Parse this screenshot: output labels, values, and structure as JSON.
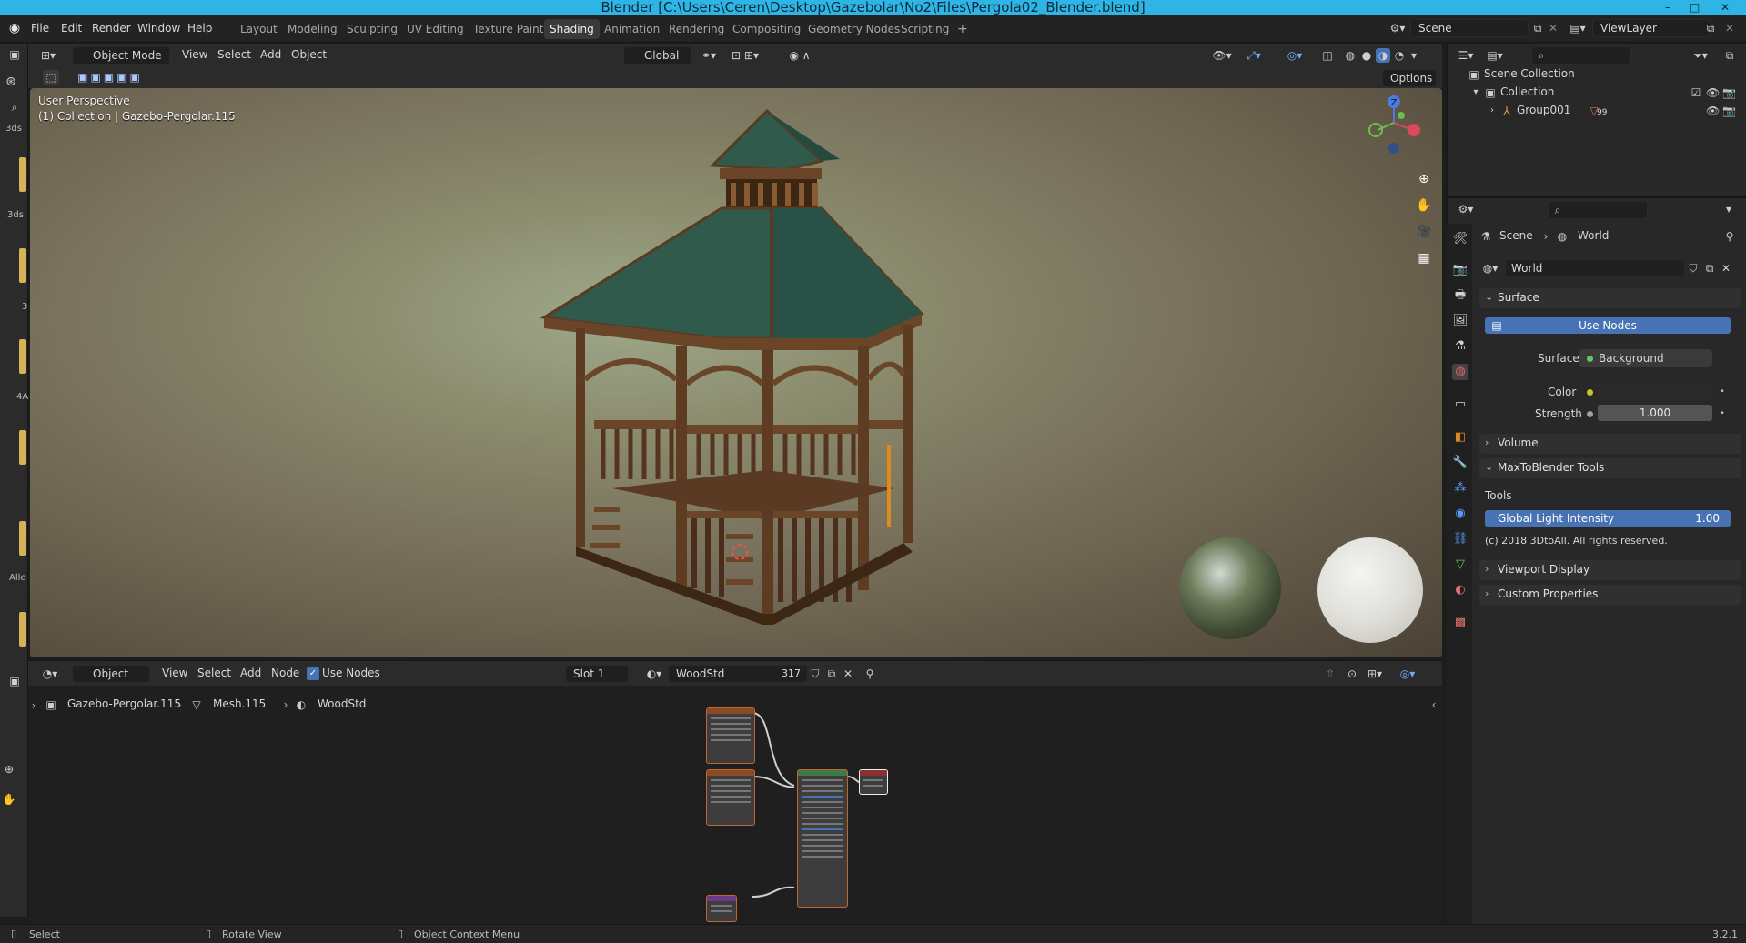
{
  "window": {
    "title": "Blender [C:\\Users\\Ceren\\Desktop\\Gazebolar\\No2\\Files\\Pergola02_Blender.blend]",
    "minimize": "–",
    "maximize": "□",
    "close": "✕"
  },
  "menu": [
    "File",
    "Edit",
    "Render",
    "Window",
    "Help"
  ],
  "workspaces": [
    "Layout",
    "Modeling",
    "Sculpting",
    "UV Editing",
    "Texture Paint",
    "Shading",
    "Animation",
    "Rendering",
    "Compositing",
    "Geometry Nodes",
    "Scripting"
  ],
  "active_workspace": "Shading",
  "add_workspace": "+",
  "scene_field": "Scene",
  "viewlayer_field": "ViewLayer",
  "viewport": {
    "mode": "Object Mode",
    "menus": [
      "View",
      "Select",
      "Add",
      "Object"
    ],
    "transform_orientation": "Global",
    "options": "Options",
    "overlay_line1": "User Perspective",
    "overlay_line2": "(1) Collection | Gazebo-Pergolar.115",
    "gizmo_z": "Z",
    "left_panel_labels": [
      "3ds",
      "3ds",
      "3",
      "4A",
      "Alle"
    ]
  },
  "outliner": {
    "root": "Scene Collection",
    "collection": "Collection",
    "group": "Group001",
    "group_badge": "99"
  },
  "properties": {
    "breadcrumb_scene": "Scene",
    "breadcrumb_world": "World",
    "world_name": "World",
    "surface_panel": "Surface",
    "use_nodes_button": "Use Nodes",
    "surface_label": "Surface",
    "surface_value": "Background",
    "color_label": "Color",
    "strength_label": "Strength",
    "strength_value": "1.000",
    "volume_panel": "Volume",
    "maxto_panel": "MaxToBlender Tools",
    "tools_label": "Tools",
    "global_light_label": "Global Light Intensity",
    "global_light_value": "1.00",
    "copyright": "(c) 2018 3DtoAll. All rights reserved.",
    "viewport_display_panel": "Viewport Display",
    "custom_props_panel": "Custom Properties"
  },
  "node_editor": {
    "object_menu": "Object",
    "menus": [
      "View",
      "Select",
      "Add",
      "Node"
    ],
    "use_nodes": "Use Nodes",
    "slot": "Slot 1",
    "material": "WoodStd",
    "users": "317",
    "breadcrumb": [
      "Gazebo-Pergolar.115",
      "Mesh.115",
      "WoodStd"
    ]
  },
  "statusbar": {
    "select": "Select",
    "rotate": "Rotate View",
    "context_menu": "Object Context Menu",
    "version": "3.2.1"
  },
  "colors": {
    "titlebar": "#2eb5e6",
    "accent_blue": "#4772b3",
    "panel_bg": "#282828",
    "roof_green": "#2f5a4c",
    "wood": "#6b4528"
  }
}
